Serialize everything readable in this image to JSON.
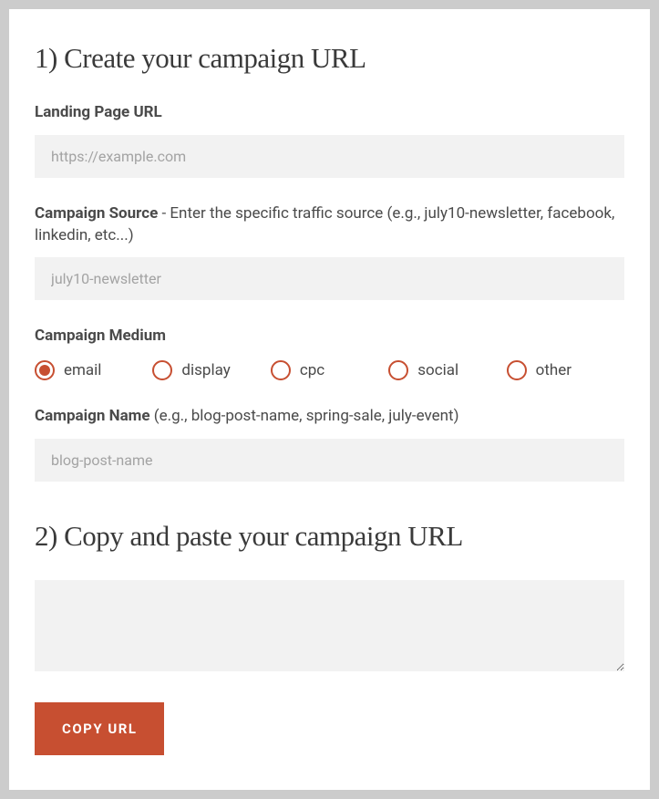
{
  "section1": {
    "heading": "1) Create your campaign URL"
  },
  "landing_page": {
    "label": "Landing Page URL",
    "placeholder": "https://example.com",
    "value": ""
  },
  "campaign_source": {
    "label_bold": "Campaign Source",
    "label_hint": " - Enter the specific traffic source (e.g., july10-newsletter, facebook, linkedin, etc...)",
    "placeholder": "july10-newsletter",
    "value": ""
  },
  "campaign_medium": {
    "label": "Campaign Medium",
    "selected": "email",
    "options": [
      {
        "value": "email",
        "label": "email"
      },
      {
        "value": "display",
        "label": "display"
      },
      {
        "value": "cpc",
        "label": "cpc"
      },
      {
        "value": "social",
        "label": "social"
      },
      {
        "value": "other",
        "label": "other"
      }
    ]
  },
  "campaign_name": {
    "label_bold": "Campaign Name",
    "label_hint": " (e.g., blog-post-name, spring-sale, july-event)",
    "placeholder": "blog-post-name",
    "value": ""
  },
  "section2": {
    "heading": "2) Copy and paste your campaign URL"
  },
  "output": {
    "value": ""
  },
  "copy_button": {
    "label": "COPY URL"
  },
  "colors": {
    "accent": "#c74f31",
    "input_bg": "#f2f2f2",
    "text_dark": "#3a3a3a",
    "text_body": "#4a4a4a",
    "placeholder": "#a3a3a3"
  }
}
